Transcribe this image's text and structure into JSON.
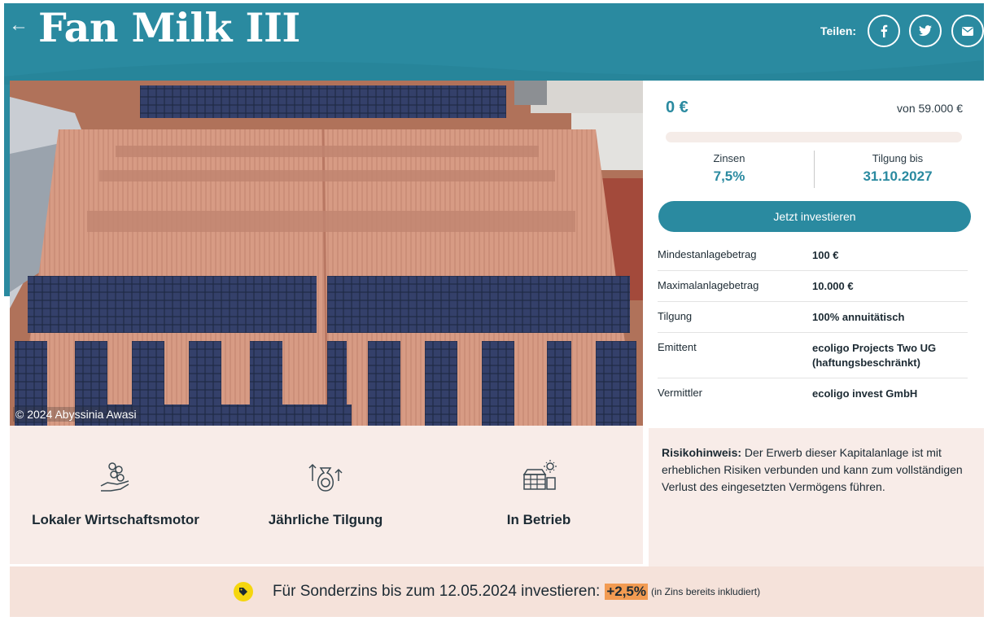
{
  "header": {
    "back_label": "←",
    "title": "Fan Milk III",
    "share_label": "Teilen:",
    "share_buttons": [
      {
        "icon": "facebook-icon"
      },
      {
        "icon": "twitter-icon"
      },
      {
        "icon": "email-icon"
      }
    ]
  },
  "photo": {
    "credit": "© 2024 Abyssinia Awasi"
  },
  "funding": {
    "amount": "0 €",
    "goal": "von 59.000 €",
    "progress": 0,
    "interest_label": "Zinsen",
    "interest_value": "7,5%",
    "repayment_label": "Tilgung bis",
    "repayment_value": "31.10.2027",
    "invest_button": "Jetzt investieren"
  },
  "details": [
    {
      "key": "Mindestanlagebetrag",
      "value": "100 €"
    },
    {
      "key": "Maximalanlagebetrag",
      "value": "10.000 €"
    },
    {
      "key": "Tilgung",
      "value": "100% annuitätisch"
    },
    {
      "key": "Emittent",
      "value": "ecoligo Projects Two UG (haftungsbeschränkt)"
    },
    {
      "key": "Vermittler",
      "value": "ecoligo invest GmbH"
    }
  ],
  "features": [
    {
      "icon": "coins-hand-icon",
      "label": "Lokaler Wirtschaftsmotor"
    },
    {
      "icon": "money-bag-arrows-icon",
      "label": "Jährliche Tilgung"
    },
    {
      "icon": "solar-panel-sun-icon",
      "label": "In Betrieb"
    }
  ],
  "risk": {
    "title": "Risikohinweis:",
    "text": " Der Erwerb dieser Kapitalanlage ist mit erheblichen Risiken verbunden und kann zum vollständigen Verlust des eingesetzten Vermögens führen."
  },
  "promo": {
    "text": "Für Sonderzins bis zum 12.05.2024 investieren:",
    "bonus": "+2,5%",
    "note": "(in Zins bereits inkludiert)"
  },
  "colors": {
    "brand_teal": "#2a8aa0",
    "beige": "#f8ece8",
    "promo_bg": "#f5e2da",
    "bonus_highlight": "#f29b52",
    "tag_yellow": "#f5d60e"
  }
}
